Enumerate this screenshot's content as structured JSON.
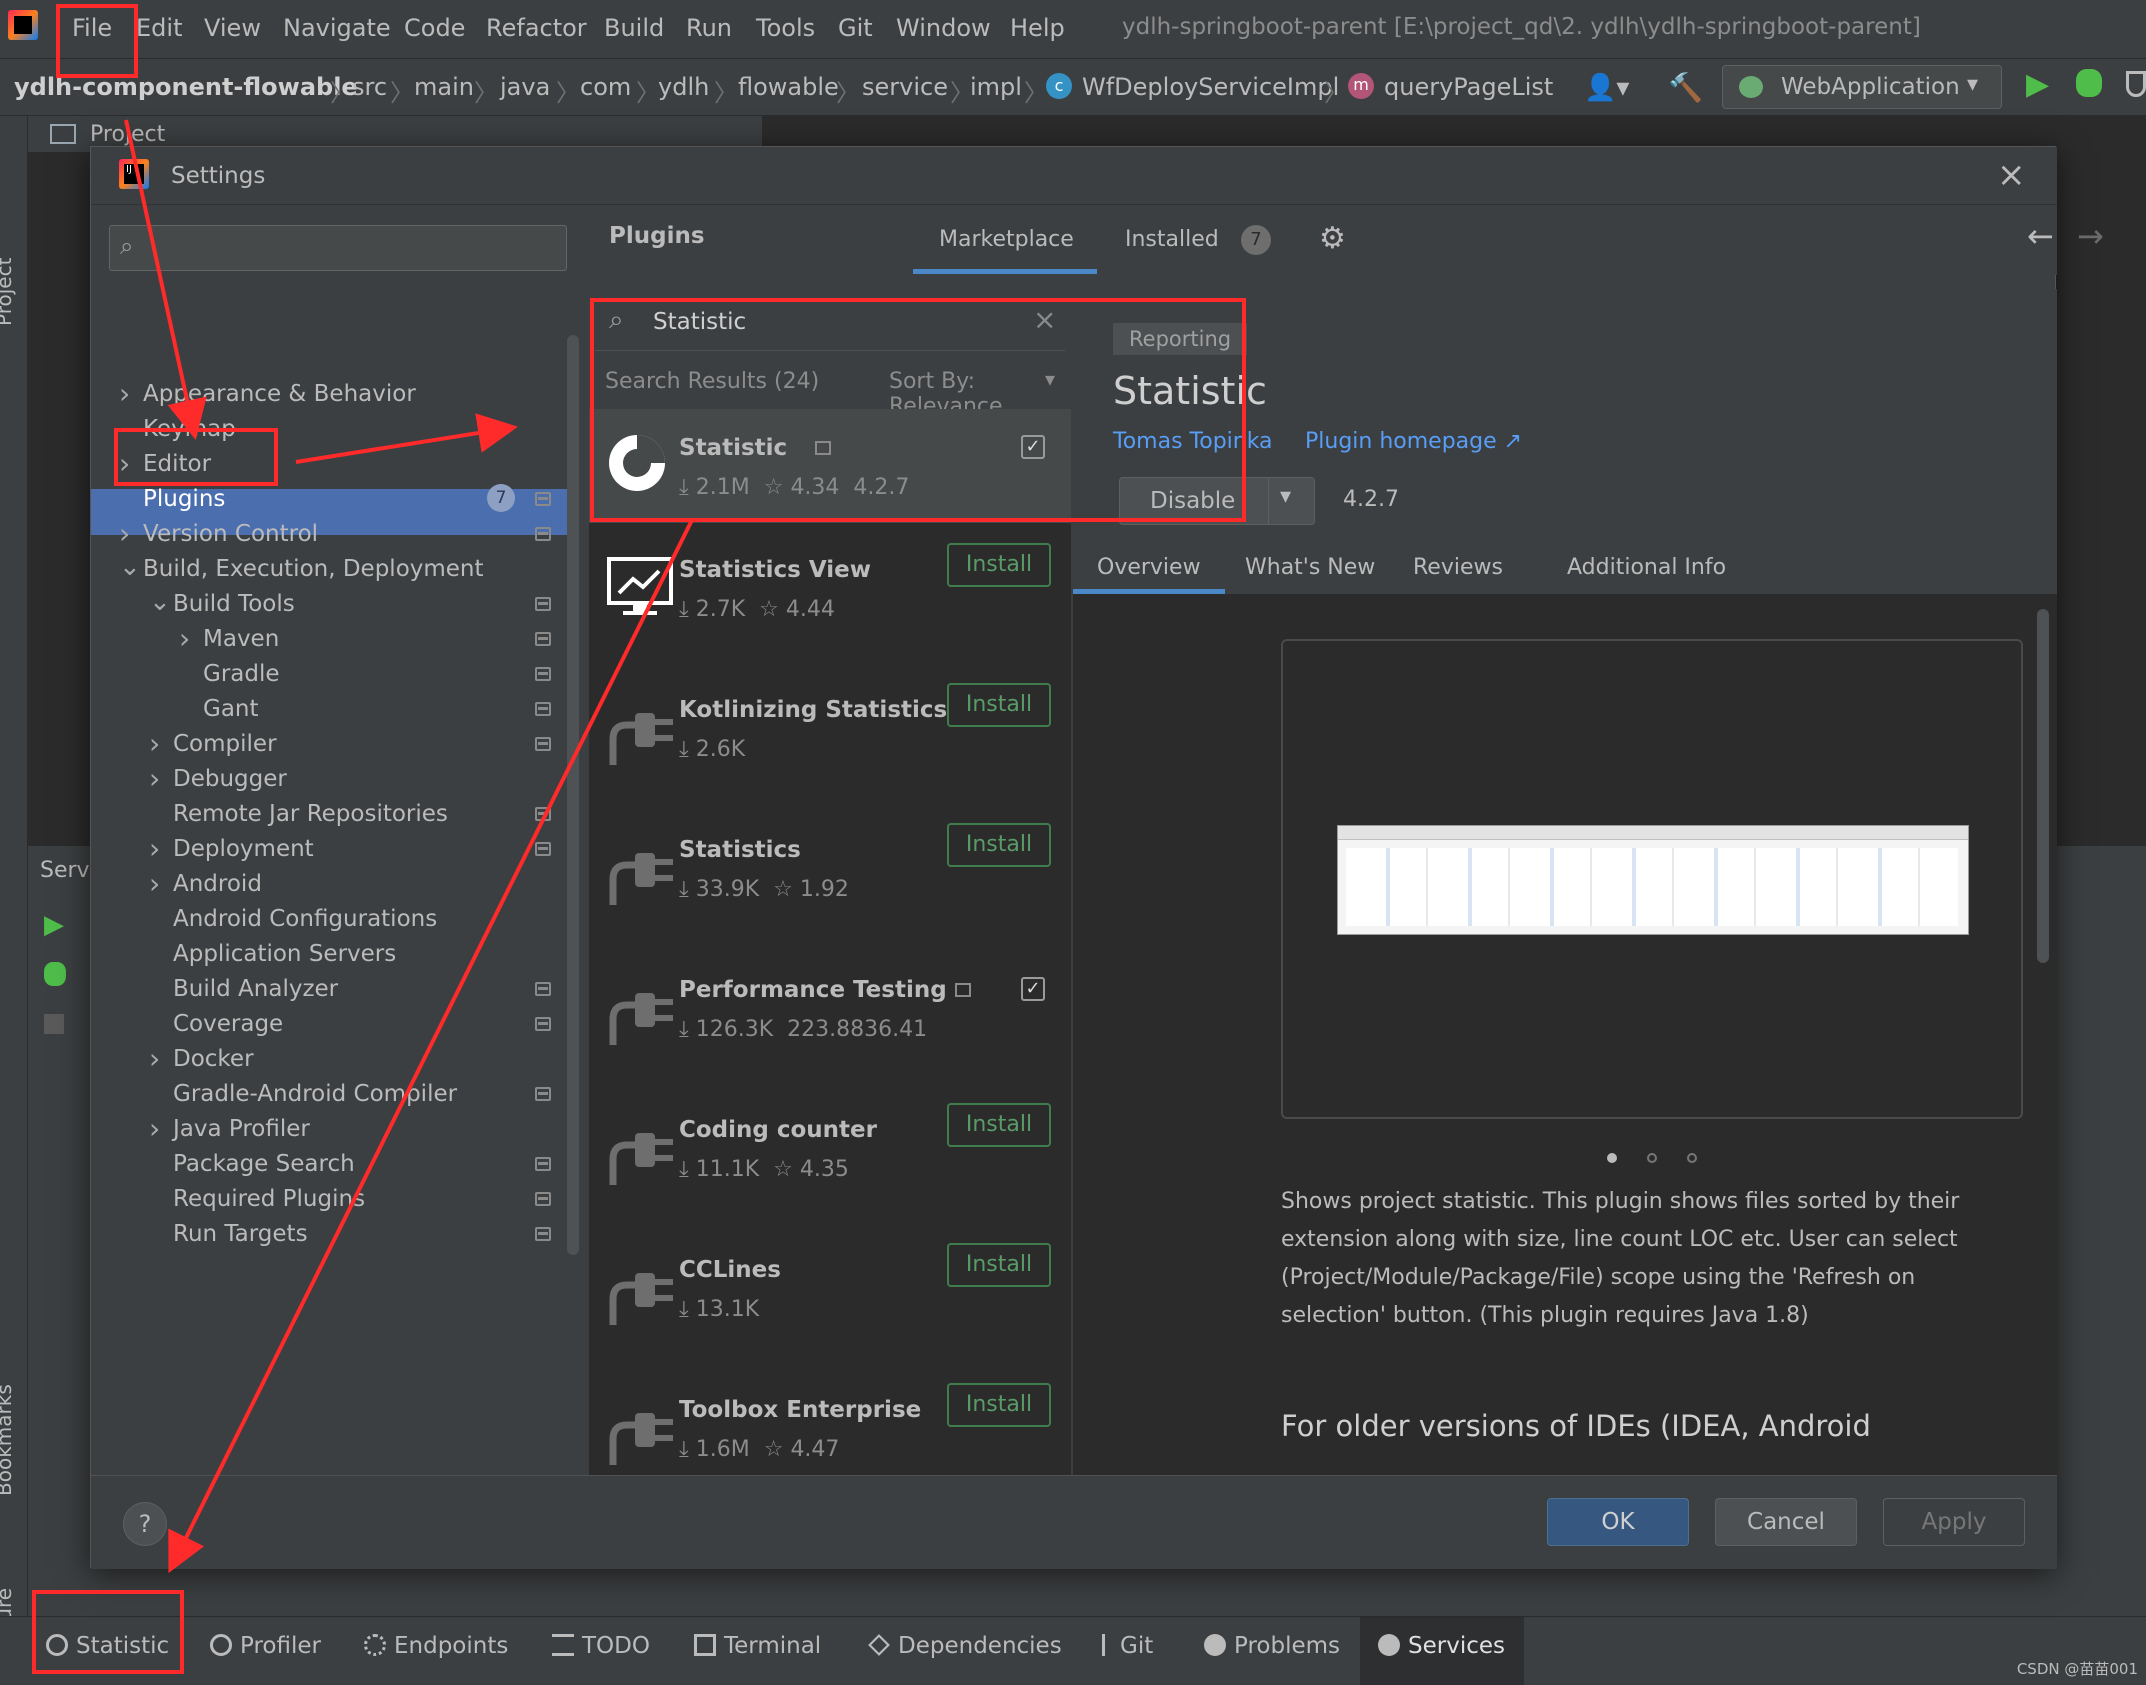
{
  "menu": [
    "File",
    "Edit",
    "View",
    "Navigate",
    "Code",
    "Refactor",
    "Build",
    "Run",
    "Tools",
    "Git",
    "Window",
    "Help"
  ],
  "project_title": "ydlh-springboot-parent [E:\\project_qd\\2. ydlh\\ydlh-springboot-parent]",
  "breadcrumb": [
    "ydlh-component-flowable",
    "src",
    "main",
    "java",
    "com",
    "ydlh",
    "flowable",
    "service",
    "impl",
    "WfDeployServiceImpl",
    "queryPageList"
  ],
  "run_config": "WebApplication",
  "left_strip": {
    "project": "Project",
    "bookmarks": "Bookmarks",
    "structure": "Structure"
  },
  "behind": {
    "project_tab": "Project",
    "services_label": "Servi"
  },
  "dialog": {
    "title": "Settings",
    "search_placeholder": "",
    "tree": [
      {
        "label": "Appearance & Behavior",
        "chev": "›"
      },
      {
        "label": "Keymap"
      },
      {
        "label": "Editor",
        "chev": "›"
      },
      {
        "label": "Plugins",
        "badge": "7"
      },
      {
        "label": "Version Control",
        "chev": "›"
      },
      {
        "label": "Build, Execution, Deployment",
        "chev": "⌄"
      },
      {
        "label": "Build Tools",
        "chev": "⌄"
      },
      {
        "label": "Maven",
        "chev": "›"
      },
      {
        "label": "Gradle"
      },
      {
        "label": "Gant"
      },
      {
        "label": "Compiler",
        "chev": "›"
      },
      {
        "label": "Debugger",
        "chev": "›"
      },
      {
        "label": "Remote Jar Repositories"
      },
      {
        "label": "Deployment",
        "chev": "›"
      },
      {
        "label": "Android",
        "chev": "›"
      },
      {
        "label": "Android Configurations"
      },
      {
        "label": "Application Servers"
      },
      {
        "label": "Build Analyzer"
      },
      {
        "label": "Coverage"
      },
      {
        "label": "Docker",
        "chev": "›"
      },
      {
        "label": "Gradle-Android Compiler"
      },
      {
        "label": "Java Profiler",
        "chev": "›"
      },
      {
        "label": "Package Search"
      },
      {
        "label": "Required Plugins"
      },
      {
        "label": "Run Targets"
      }
    ],
    "header": {
      "title": "Plugins",
      "tab_marketplace": "Marketplace",
      "tab_installed": "Installed",
      "installed_count": "7"
    },
    "search": {
      "value": "Statistic",
      "results": "Search Results (24)",
      "sort": "Sort By: Relevance"
    },
    "plugins": [
      {
        "name": "Statistic",
        "downloads": "2.1M",
        "rating": "4.34",
        "version": "4.2.7",
        "state": "checked"
      },
      {
        "name": "Statistics View",
        "downloads": "2.7K",
        "rating": "4.44",
        "state": "install"
      },
      {
        "name": "Kotlinizing Statistics",
        "downloads": "2.6K",
        "rating": "",
        "state": "install"
      },
      {
        "name": "Statistics",
        "downloads": "33.9K",
        "rating": "1.92",
        "state": "install"
      },
      {
        "name": "Performance Testing",
        "downloads": "126.3K",
        "rating": "223.8836.41",
        "state": "checked"
      },
      {
        "name": "Coding counter",
        "downloads": "11.1K",
        "rating": "4.35",
        "state": "install"
      },
      {
        "name": "CCLines",
        "downloads": "13.1K",
        "rating": "",
        "state": "install"
      },
      {
        "name": "Toolbox Enterprise",
        "downloads": "1.6M",
        "rating": "4.47",
        "state": "install"
      }
    ],
    "install_label": "Install",
    "detail": {
      "tag": "Reporting",
      "name": "Statistic",
      "author": "Tomas Topinka",
      "homepage": "Plugin homepage ↗",
      "disable": "Disable",
      "version": "4.2.7",
      "tabs": [
        "Overview",
        "What's New",
        "Reviews",
        "Additional Info"
      ],
      "description": "Shows project statistic. This plugin shows files sorted by their extension along with size, line count LOC etc. User can select (Project/Module/Package/File) scope using the 'Refresh on selection' button. (This plugin requires Java 1.8)",
      "older_heading": "For older versions of IDEs (IDEA, Android"
    },
    "buttons": {
      "ok": "OK",
      "cancel": "Cancel",
      "apply": "Apply"
    }
  },
  "bottom_tabs": [
    "Statistic",
    "Profiler",
    "Endpoints",
    "TODO",
    "Terminal",
    "Dependencies",
    "Git",
    "Problems",
    "Services"
  ],
  "watermark": "CSDN @苗苗001",
  "colors": {
    "selection": "#4b6eaf",
    "annotation": "#ff2a2a",
    "install": "#3f7d4c",
    "run": "#4fbd49"
  }
}
